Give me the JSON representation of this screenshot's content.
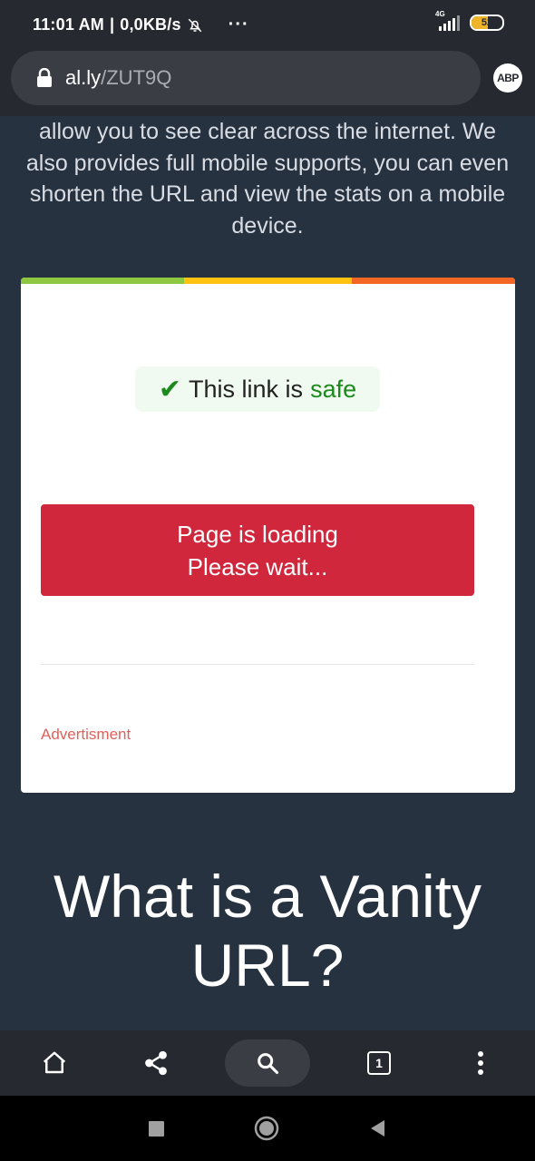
{
  "status_bar": {
    "time": "11:01 AM",
    "separator": "|",
    "speed": "0,0KB/s",
    "more": "···",
    "network": "4G",
    "battery_level": "52",
    "battery_percent": 52
  },
  "address_bar": {
    "domain": "al.ly",
    "path": "/ZUT9Q",
    "adblock_label": "ABP"
  },
  "page": {
    "intro": "allow you to see clear across the internet. We also provides full mobile supports, you can even shorten the URL and view the stats on a mobile device.",
    "safe_badge": {
      "check": "✔",
      "text": "This link is",
      "highlight": "safe"
    },
    "loading_button": {
      "line1": "Page is loading",
      "line2": "Please wait..."
    },
    "ad_label": "Advertisment",
    "heading": "What is a Vanity URL?"
  },
  "toolbar": {
    "tab_count": "1"
  },
  "colors": {
    "background": "#273241",
    "button_red": "#d0273d",
    "safe_green": "#1a8a1a",
    "bar_green": "#8dc63f",
    "bar_yellow": "#ffc20e",
    "bar_orange": "#f26522"
  }
}
